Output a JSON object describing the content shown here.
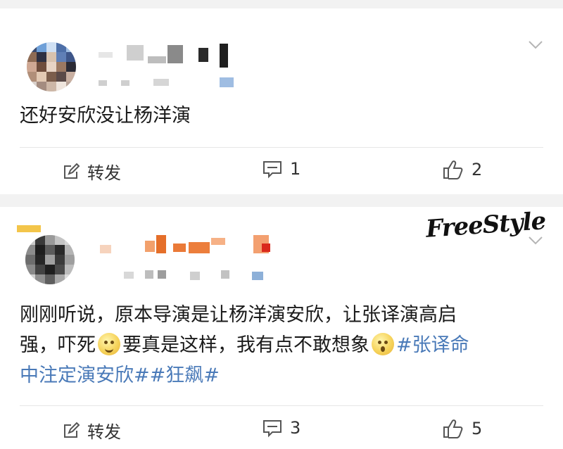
{
  "posts": [
    {
      "text": "还好安欣没让杨洋演",
      "actions": {
        "repost_label": "转发",
        "comment_count": "1",
        "like_count": "2"
      }
    },
    {
      "text_line1": "刚刚听说，原本导演是让杨洋演安欣，让张译演高启",
      "text_line2_a": "强，吓死",
      "text_line2_b": "要真是这样，我有点不敢想象",
      "text_line2_tag": "#张译命",
      "text_line3_tag": "中注定演安欣##狂飙#",
      "actions": {
        "repost_label": "转发",
        "comment_count": "3",
        "like_count": "5"
      }
    }
  ],
  "watermark": "FreeStyle",
  "colors": {
    "tag": "#4a7ab8",
    "background": "#f2f2f2"
  }
}
